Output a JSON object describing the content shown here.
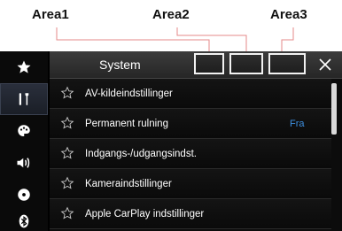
{
  "callouts": {
    "area1": "Area1",
    "area2": "Area2",
    "area3": "Area3"
  },
  "header": {
    "title": "System",
    "close_label": "×"
  },
  "sidebar": {
    "items": [
      {
        "icon": "star-icon"
      },
      {
        "icon": "tools-icon",
        "active": true
      },
      {
        "icon": "palette-icon"
      },
      {
        "icon": "speaker-icon"
      },
      {
        "icon": "disc-icon"
      },
      {
        "icon": "bluetooth-icon"
      }
    ]
  },
  "menu": {
    "items": [
      {
        "label": "AV-kildeindstillinger",
        "value": ""
      },
      {
        "label": "Permanent rulning",
        "value": "Fra"
      },
      {
        "label": "Indgangs-/udgangsindst.",
        "value": ""
      },
      {
        "label": "Kameraindstillinger",
        "value": ""
      },
      {
        "label": "Apple CarPlay indstillinger",
        "value": ""
      }
    ]
  },
  "colors": {
    "accent": "#3d8fe0",
    "background": "#000000",
    "text": "#ffffff"
  }
}
